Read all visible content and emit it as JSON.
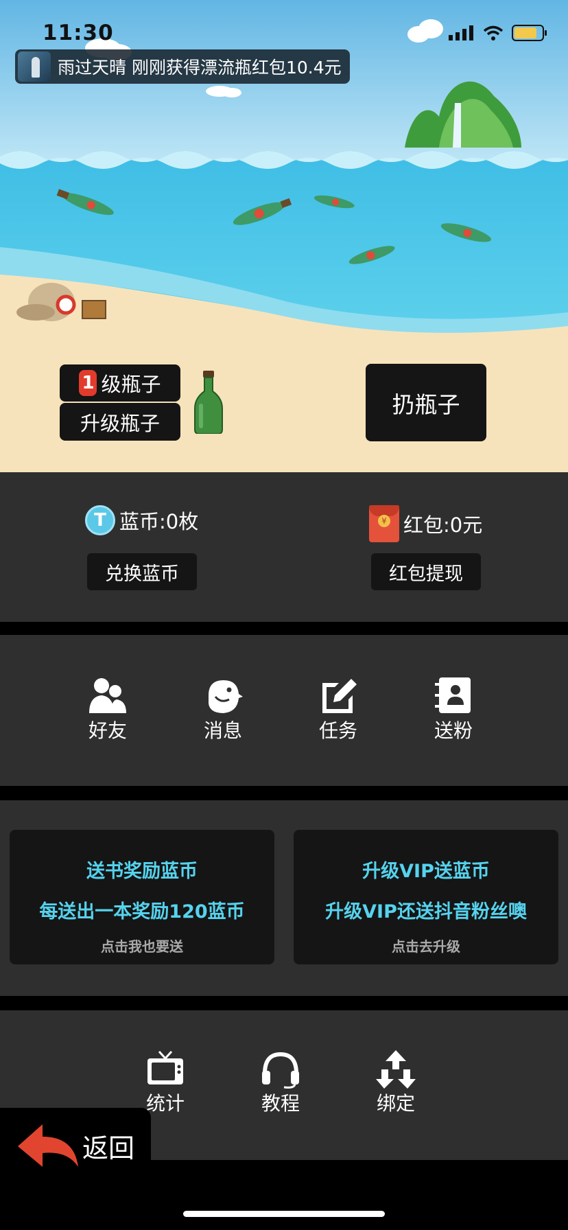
{
  "status_bar": {
    "time": "11:30"
  },
  "ticker": {
    "message": "雨过天晴 刚刚获得漂流瓶红包10.4元"
  },
  "bottle": {
    "level_number": "1",
    "level_label": "级瓶子",
    "upgrade_label": "升级瓶子",
    "throw_label": "扔瓶子"
  },
  "wallet": {
    "blue_coin_icon_letter": "T",
    "blue_coin_text": "蓝币:0枚",
    "red_packet_text": "红包:0元",
    "exchange_label": "兑换蓝币",
    "withdraw_label": "红包提现"
  },
  "nav": {
    "items": [
      {
        "label": "好友",
        "icon": "friends-icon"
      },
      {
        "label": "消息",
        "icon": "bird-message-icon"
      },
      {
        "label": "任务",
        "icon": "task-edit-icon"
      },
      {
        "label": "送粉",
        "icon": "contacts-icon"
      }
    ]
  },
  "promos": [
    {
      "title": "送书奖励蓝币",
      "subtitle": "每送出一本奖励120蓝币",
      "link": "点击我也要送"
    },
    {
      "title": "升级VIP送蓝币",
      "subtitle": "升级VIP还送抖音粉丝噢",
      "link": "点击去升级"
    }
  ],
  "bottom_nav": {
    "items": [
      {
        "label": "统计",
        "icon": "tv-icon"
      },
      {
        "label": "教程",
        "icon": "headphones-icon"
      },
      {
        "label": "绑定",
        "icon": "bind-arrows-icon"
      }
    ]
  },
  "back": {
    "label": "返回"
  },
  "colors": {
    "accent_cyan": "#55d3ee",
    "panel_bg": "#2f2f2f",
    "button_bg": "#151515",
    "badge_red": "#e23b2c",
    "sand": "#f7e3bb",
    "sea": "#4fc6e6"
  }
}
